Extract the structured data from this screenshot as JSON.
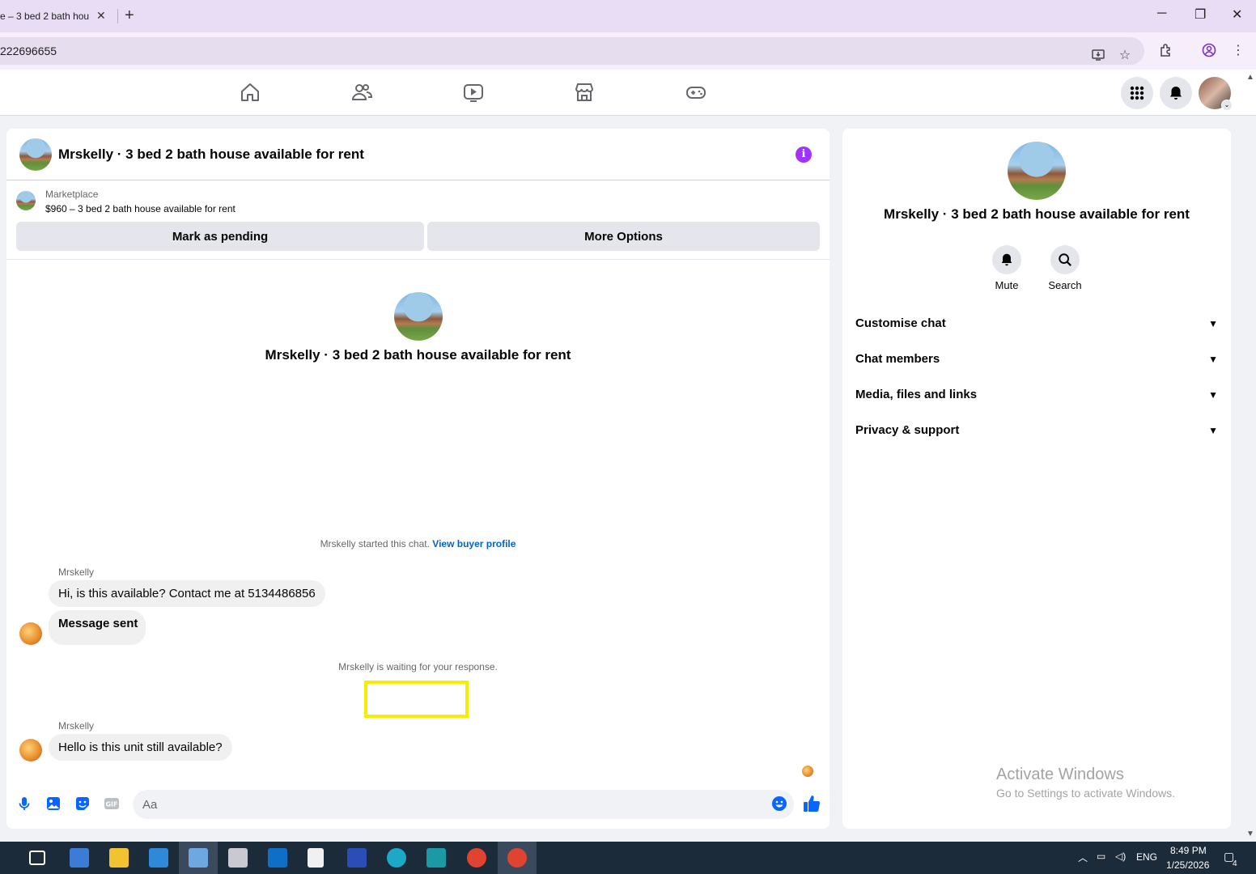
{
  "browser": {
    "tab_title": "e – 3 bed 2 bath hou",
    "url": "222696655",
    "new_tab": "+",
    "tab_close": "✕",
    "window_min": "─",
    "window_max": "❐",
    "window_close": "✕"
  },
  "chat": {
    "title": "Mrskelly · 3 bed 2 bath house available for rent",
    "marketplace_label": "Marketplace",
    "listing": "$960 – 3 bed 2 bath house available for rent",
    "mark_pending": "Mark as pending",
    "more_options": "More Options",
    "center_title": "Mrskelly · 3 bed 2 bath house available for rent",
    "started_text": "Mrskelly started this chat.",
    "view_buyer_profile": "View buyer profile",
    "messages": [
      {
        "sender": "Mrskelly",
        "text": "Hi, is this available? Contact me at 5134486856"
      },
      {
        "text": "Message sent"
      }
    ],
    "waiting_text": "Mrskelly is waiting for your response.",
    "messages2": [
      {
        "sender": "Mrskelly",
        "text": "Hello is this unit still available?"
      }
    ],
    "composer_placeholder": "Aa"
  },
  "info_panel": {
    "name": "Mrskelly · 3 bed 2 bath house available for rent",
    "actions": [
      {
        "label": "Mute",
        "icon": "bell-icon"
      },
      {
        "label": "Search",
        "icon": "search-icon"
      }
    ],
    "sections": [
      "Customise chat",
      "Chat members",
      "Media, files and links",
      "Privacy & support"
    ]
  },
  "watermark": {
    "line1": "Activate Windows",
    "line2": "Go to Settings to activate Windows."
  },
  "taskbar": {
    "lang": "ENG",
    "time": "8:49 PM",
    "date": "1/25/2026",
    "notif_count": "4"
  },
  "colors": {
    "accent_purple": "#a033ff",
    "fb_blue": "#0866ff",
    "link_blue": "#0064d1",
    "highlight_yellow": "#f6ee00"
  }
}
